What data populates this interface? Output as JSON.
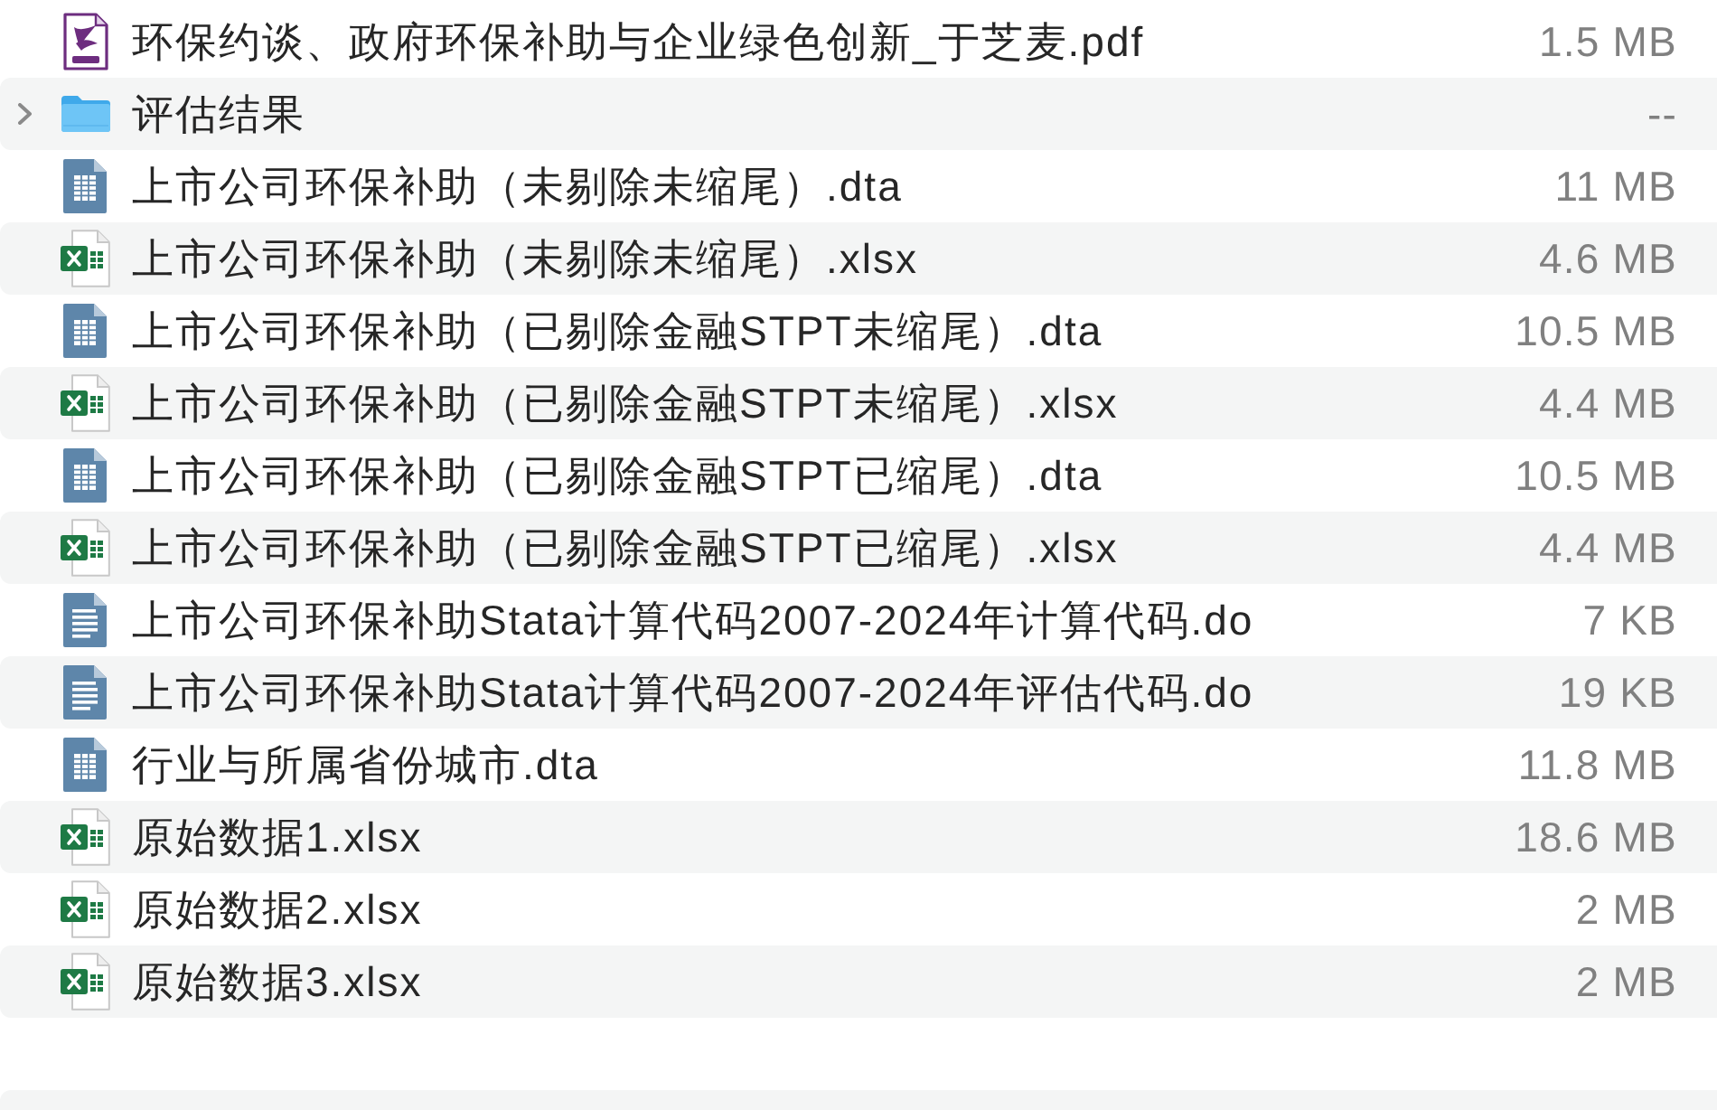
{
  "files": [
    {
      "kind": "pdf",
      "name": "环保约谈、政府环保补助与企业绿色创新_于芝麦.pdf",
      "size": "1.5 MB"
    },
    {
      "kind": "folder",
      "name": "评估结果",
      "size": "--",
      "expanded": false
    },
    {
      "kind": "dta",
      "name": "上市公司环保补助（未剔除未缩尾）.dta",
      "size": "11 MB"
    },
    {
      "kind": "xlsx",
      "name": "上市公司环保补助（未剔除未缩尾）.xlsx",
      "size": "4.6 MB"
    },
    {
      "kind": "dta",
      "name": "上市公司环保补助（已剔除金融STPT未缩尾）.dta",
      "size": "10.5 MB"
    },
    {
      "kind": "xlsx",
      "name": "上市公司环保补助（已剔除金融STPT未缩尾）.xlsx",
      "size": "4.4 MB"
    },
    {
      "kind": "dta",
      "name": "上市公司环保补助（已剔除金融STPT已缩尾）.dta",
      "size": "10.5 MB"
    },
    {
      "kind": "xlsx",
      "name": "上市公司环保补助（已剔除金融STPT已缩尾）.xlsx",
      "size": "4.4 MB"
    },
    {
      "kind": "do",
      "name": "上市公司环保补助Stata计算代码2007-2024年计算代码.do",
      "size": "7 KB"
    },
    {
      "kind": "do",
      "name": "上市公司环保补助Stata计算代码2007-2024年评估代码.do",
      "size": "19 KB"
    },
    {
      "kind": "dta",
      "name": "行业与所属省份城市.dta",
      "size": "11.8 MB"
    },
    {
      "kind": "xlsx",
      "name": "原始数据1.xlsx",
      "size": "18.6 MB"
    },
    {
      "kind": "xlsx",
      "name": "原始数据2.xlsx",
      "size": "2 MB"
    },
    {
      "kind": "xlsx",
      "name": "原始数据3.xlsx",
      "size": "2 MB"
    }
  ]
}
